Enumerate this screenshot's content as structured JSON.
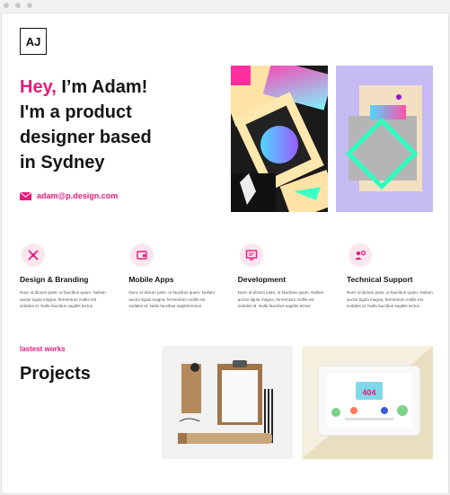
{
  "logo": {
    "text": "AJ"
  },
  "hero": {
    "greeting": "Hey,",
    "intro": " I’m Adam!",
    "line2": "I'm a product",
    "line3": "designer based",
    "line4": "in Sydney",
    "email": "adam@p.design.com"
  },
  "services": [
    {
      "title": "Design & Branding",
      "desc": "Nunc id dictum justo, ut faucibus quam. Nullam auctor ligula magna, fermentum mollis est sodales id. Nulla faucibus sagittis lectus",
      "icon": "design-tools-icon"
    },
    {
      "title": "Mobile Apps",
      "desc": "Nunc id dictum justo, ut faucibus quam. Nullam auctor ligula magna, fermentum mollis est sodales id. Nulla faucibus sagittis lectus",
      "icon": "mobile-app-icon"
    },
    {
      "title": "Development",
      "desc": "Nunc id dictum justo, ut faucibus quam. Nullam auctor ligula magna, fermentum mollis est sodales id. Nulla faucibus sagittis lectus",
      "icon": "monitor-code-icon"
    },
    {
      "title": "Technical Support",
      "desc": "Nunc id dictum justo, ut faucibus quam. Nullam auctor ligula magna, fermentum mollis est sodales id. Nulla faucibus sagittis lectus",
      "icon": "support-gear-icon"
    }
  ],
  "works": {
    "kicker": "lastest works",
    "title": "Projects"
  },
  "colors": {
    "accent": "#e8197d",
    "text": "#151515",
    "icon_bg": "#fbe6ef"
  }
}
